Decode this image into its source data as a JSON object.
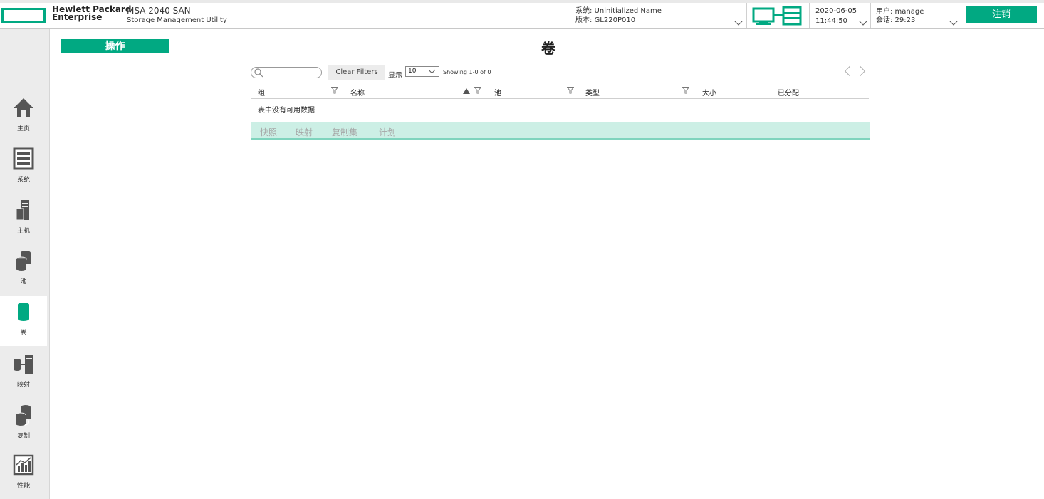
{
  "header": {
    "brand_line1": "Hewlett Packard",
    "brand_line2": "Enterprise",
    "product_name": "MSA 2040 SAN",
    "product_subtitle": "Storage Management Utility",
    "system_label": "系统: Uninitialized Name",
    "version_label": "版本: GL220P010",
    "date": "2020-06-05",
    "time": "11:44:50",
    "user_label": "用户: manage",
    "session_label": "会话: 29:23",
    "logout_label": "注销",
    "accent_color": "#01a982"
  },
  "sidebar": {
    "items": [
      {
        "label": "主页",
        "icon": "home-icon"
      },
      {
        "label": "系统",
        "icon": "system-icon"
      },
      {
        "label": "主机",
        "icon": "hosts-icon"
      },
      {
        "label": "池",
        "icon": "pools-icon"
      },
      {
        "label": "卷",
        "icon": "volumes-icon",
        "active": true
      },
      {
        "label": "映射",
        "icon": "mapping-icon"
      },
      {
        "label": "复制",
        "icon": "replication-icon"
      },
      {
        "label": "性能",
        "icon": "performance-icon"
      }
    ]
  },
  "main": {
    "actions_label": "操作",
    "title": "卷",
    "search_placeholder": "",
    "clear_filters_label": "Clear Filters",
    "show_label": "显示",
    "page_size": "10",
    "showing_text": "Showing 1-0 of 0",
    "columns": [
      "组",
      "名称",
      "池",
      "类型",
      "大小",
      "已分配"
    ],
    "empty_message": "表中没有可用数据",
    "tabs": [
      "快照",
      "映射",
      "复制集",
      "计划"
    ]
  }
}
